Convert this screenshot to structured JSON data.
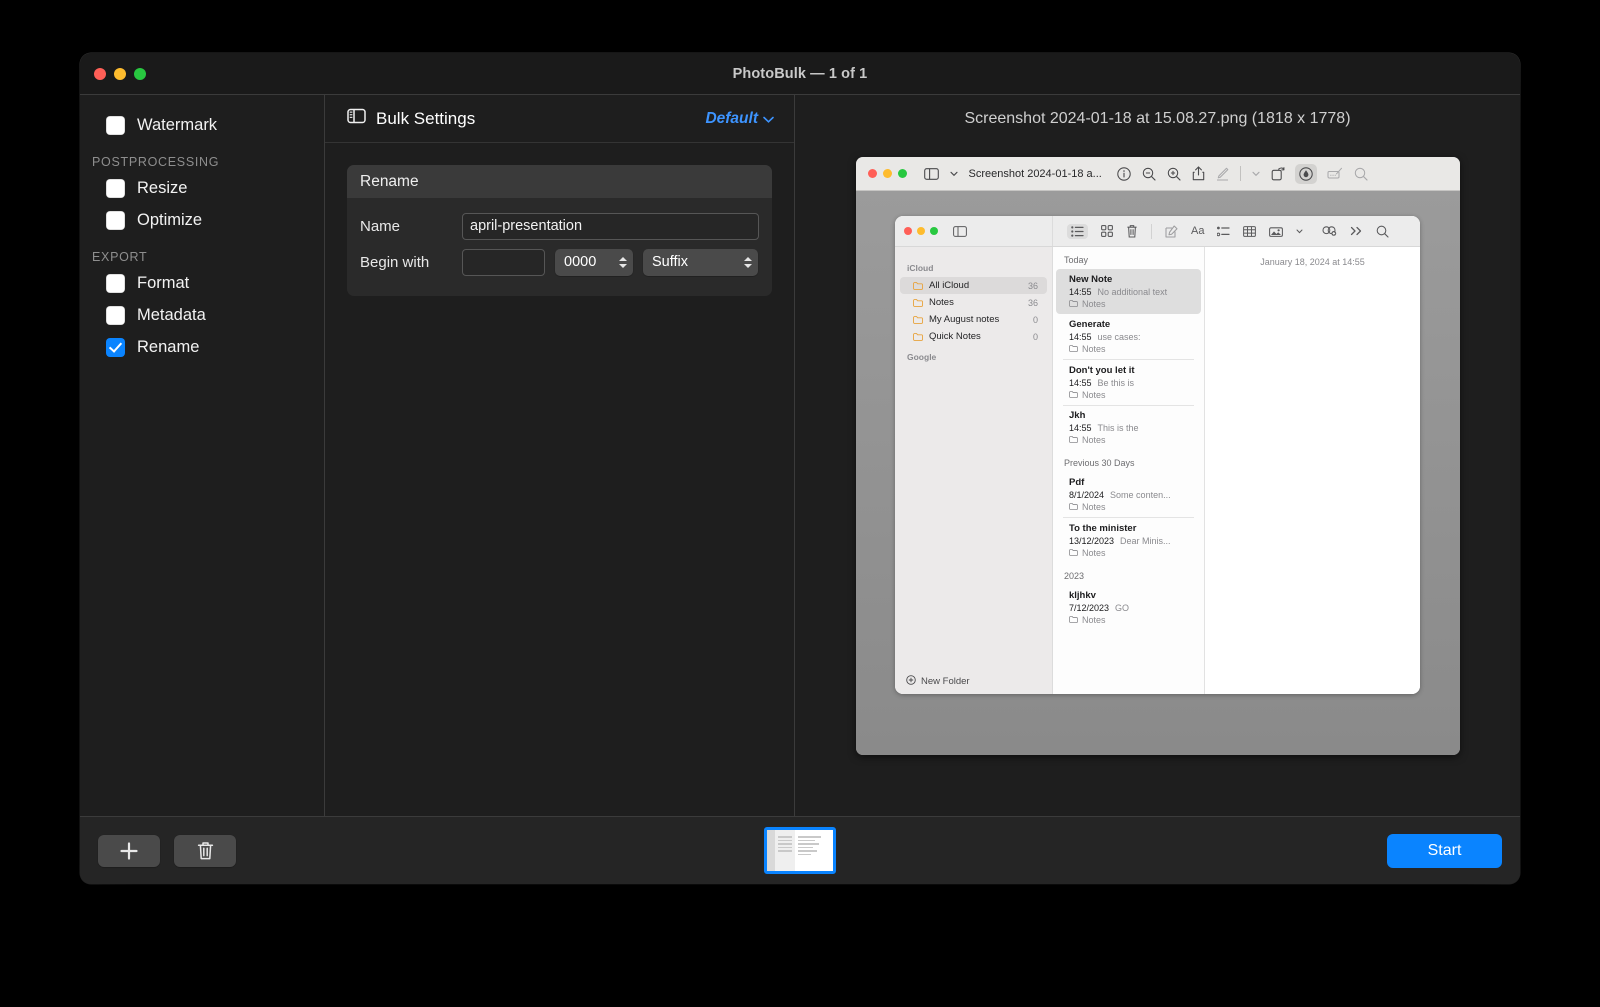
{
  "window": {
    "title": "PhotoBulk — 1 of 1",
    "traffic_lights": [
      "close",
      "minimize",
      "zoom"
    ]
  },
  "sidebar": {
    "items": [
      {
        "label": "Watermark",
        "checked": false
      }
    ],
    "groups": [
      {
        "title": "POSTPROCESSING",
        "items": [
          {
            "label": "Resize",
            "checked": false
          },
          {
            "label": "Optimize",
            "checked": false
          }
        ]
      },
      {
        "title": "EXPORT",
        "items": [
          {
            "label": "Format",
            "checked": false
          },
          {
            "label": "Metadata",
            "checked": false
          },
          {
            "label": "Rename",
            "checked": true
          }
        ]
      }
    ]
  },
  "settings": {
    "header_title": "Bulk Settings",
    "preset_label": "Default",
    "card": {
      "title": "Rename",
      "name_label": "Name",
      "name_value": "april-presentation",
      "begin_label": "Begin with",
      "begin_value": "",
      "counter_value": "0000",
      "position_value": "Suffix"
    }
  },
  "preview": {
    "filename": "Screenshot 2024-01-18 at 15.08.27.png (1818 x 1778)",
    "preview_window": {
      "title": "Screenshot 2024-01-18 a...",
      "toolbar_icons": [
        "sidebar-icon",
        "chevron-down-icon",
        "info-icon",
        "zoom-out-icon",
        "zoom-in-icon",
        "share-icon",
        "markup-icon",
        "chevron-down-icon",
        "rotate-icon",
        "annotate-icon",
        "signature-icon",
        "search-icon"
      ]
    },
    "notes_window": {
      "toolbar_icons": [
        "sidebar-icon",
        "list-view-icon",
        "gallery-view-icon",
        "delete-icon",
        "compose-icon",
        "format-icon",
        "checklist-icon",
        "table-icon",
        "media-icon",
        "chevron-down-icon",
        "share-note-icon",
        "more-icon",
        "search-icon"
      ],
      "sidebar": {
        "groups": [
          {
            "title": "iCloud",
            "rows": [
              {
                "label": "All iCloud",
                "count": "36",
                "selected": true
              },
              {
                "label": "Notes",
                "count": "36",
                "selected": false
              },
              {
                "label": "My August notes",
                "count": "0",
                "selected": false
              },
              {
                "label": "Quick Notes",
                "count": "0",
                "selected": false
              }
            ]
          },
          {
            "title": "Google",
            "rows": []
          }
        ],
        "new_folder_label": "New Folder"
      },
      "list": [
        {
          "group": "Today",
          "notes": [
            {
              "title": "New Note",
              "date": "14:55",
              "snippet": "No additional text",
              "folder": "Notes",
              "selected": true
            },
            {
              "title": "Generate",
              "date": "14:55",
              "snippet": "use cases:",
              "folder": "Notes",
              "selected": false
            },
            {
              "title": "Don't you let it",
              "date": "14:55",
              "snippet": "Be this is",
              "folder": "Notes",
              "selected": false
            },
            {
              "title": "Jkh",
              "date": "14:55",
              "snippet": "This is the",
              "folder": "Notes",
              "selected": false
            }
          ]
        },
        {
          "group": "Previous 30 Days",
          "notes": [
            {
              "title": "Pdf",
              "date": "8/1/2024",
              "snippet": "Some conten...",
              "folder": "Notes",
              "selected": false
            },
            {
              "title": "To the minister",
              "date": "13/12/2023",
              "snippet": "Dear Minis...",
              "folder": "Notes",
              "selected": false
            }
          ]
        },
        {
          "group": "2023",
          "notes": [
            {
              "title": "kljhkv",
              "date": "7/12/2023",
              "snippet": "GO",
              "folder": "Notes",
              "selected": false
            }
          ]
        }
      ],
      "detail_date": "January 18, 2024 at 14:55"
    }
  },
  "bottombar": {
    "add_label": "+",
    "delete_label": "trash",
    "start_label": "Start"
  },
  "colors": {
    "accent": "#0a84ff",
    "window_bg": "#1e1e1e",
    "titlebar_bg": "#1a1a1a",
    "card_header": "#3a3a3a",
    "folder_orange": "#e8a33d"
  }
}
